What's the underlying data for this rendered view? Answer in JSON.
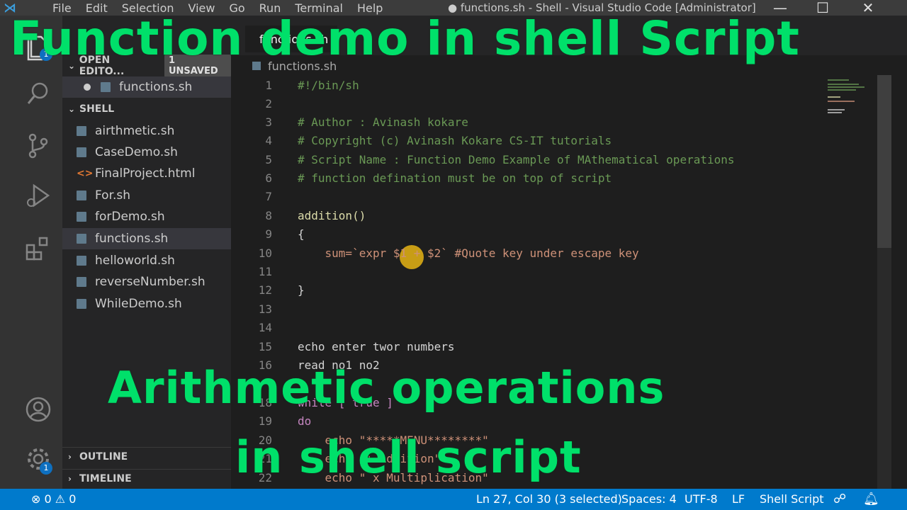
{
  "window": {
    "title": "● functions.sh - Shell - Visual Studio Code [Administrator]",
    "menu": [
      "File",
      "Edit",
      "Selection",
      "View",
      "Go",
      "Run",
      "Terminal",
      "Help"
    ],
    "controls": {
      "minimize": "—",
      "maximize": "☐",
      "close": "✕"
    }
  },
  "activity_bar": {
    "icons": [
      "explorer-icon",
      "search-icon",
      "source-control-icon",
      "run-debug-icon",
      "extensions-icon",
      "accounts-icon",
      "settings-gear-icon"
    ],
    "explorer_badge": "1",
    "settings_badge": "1"
  },
  "sidebar": {
    "open_editors": {
      "label": "OPEN EDITO...",
      "badge": "1 UNSAVED",
      "files": [
        "functions.sh"
      ]
    },
    "folder": {
      "label": "SHELL",
      "files": [
        {
          "name": "airthmetic.sh",
          "type": "sh"
        },
        {
          "name": "CaseDemo.sh",
          "type": "sh"
        },
        {
          "name": "FinalProject.html",
          "type": "html"
        },
        {
          "name": "For.sh",
          "type": "sh"
        },
        {
          "name": "forDemo.sh",
          "type": "sh"
        },
        {
          "name": "functions.sh",
          "type": "sh",
          "active": true
        },
        {
          "name": "helloworld.sh",
          "type": "sh"
        },
        {
          "name": "reverseNumber.sh",
          "type": "sh"
        },
        {
          "name": "WhileDemo.sh",
          "type": "sh"
        }
      ]
    },
    "outline_label": "OUTLINE",
    "timeline_label": "TIMELINE"
  },
  "editor": {
    "tab_label": "functions.sh",
    "breadcrumb": "functions.sh",
    "lines": [
      {
        "n": "1",
        "text": "#!/bin/sh"
      },
      {
        "n": "2",
        "text": ""
      },
      {
        "n": "3",
        "text": "# Author : Avinash kokare"
      },
      {
        "n": "4",
        "text": "# Copyright (c) Avinash Kokare CS-IT tutorials"
      },
      {
        "n": "5",
        "text": "# Script Name : Function Demo Example of MAthematical operations"
      },
      {
        "n": "6",
        "text": "# function defination must be on top of script"
      },
      {
        "n": "7",
        "text": ""
      },
      {
        "n": "8",
        "text": "addition()"
      },
      {
        "n": "9",
        "text": "{"
      },
      {
        "n": "10",
        "text": "    sum=`expr $1 + $2` #Quote key under escape key"
      },
      {
        "n": "11",
        "text": ""
      },
      {
        "n": "12",
        "text": "}"
      },
      {
        "n": "13",
        "text": ""
      },
      {
        "n": "14",
        "text": ""
      },
      {
        "n": "15",
        "text": "echo enter twor numbers"
      },
      {
        "n": "16",
        "text": "read no1 no2"
      },
      {
        "n": "18",
        "text": "while [ true ]"
      },
      {
        "n": "19",
        "text": "do"
      },
      {
        "n": "20",
        "text": "    echo \"*****MENU********\""
      },
      {
        "n": "21",
        "text": "    echo \"+ Addition\""
      },
      {
        "n": "22",
        "text": "    echo \" x Multiplication\""
      }
    ]
  },
  "status_bar": {
    "errors": "0",
    "warnings": "0",
    "position": "Ln 27, Col 30 (3 selected)",
    "spaces": "Spaces: 4",
    "encoding": "UTF-8",
    "eol": "LF",
    "language": "Shell Script"
  },
  "overlay": {
    "title": "Function demo in shell Script",
    "subtitle_line1": "Arithmetic operations",
    "subtitle_line2": "in shell script"
  },
  "colors": {
    "accent": "#007acc",
    "caption": "#00e06a",
    "comment": "#6a9955",
    "function": "#dcdcaa",
    "keyword": "#c586c0",
    "string": "#ce9178"
  }
}
